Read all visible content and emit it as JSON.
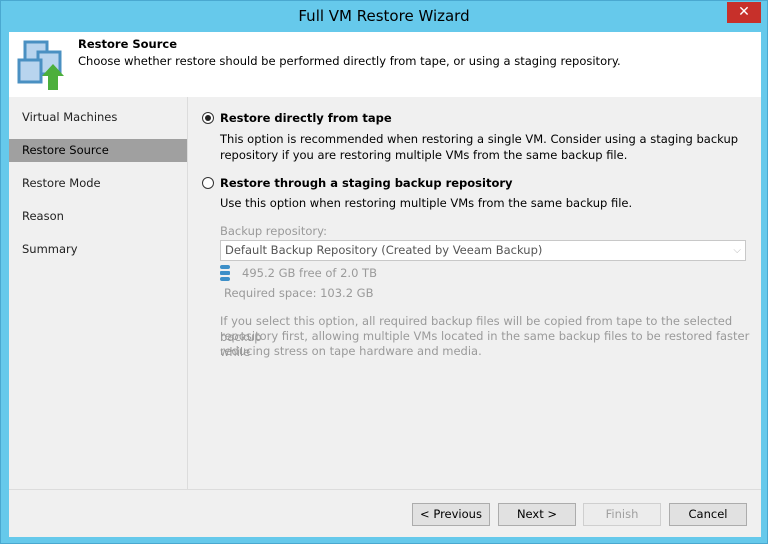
{
  "window": {
    "title": "Full VM Restore Wizard",
    "close": "✕"
  },
  "header": {
    "title": "Restore Source",
    "description": "Choose whether restore should be performed directly from tape, or using a staging repository."
  },
  "nav": [
    "Virtual Machines",
    "Restore Source",
    "Restore Mode",
    "Reason",
    "Summary"
  ],
  "options": {
    "direct": {
      "label": "Restore directly from tape",
      "desc1": "This option is recommended when restoring a single VM. Consider using a staging backup",
      "desc2": "repository if you are restoring multiple VMs from the same backup file."
    },
    "staging": {
      "label": "Restore through a staging backup repository",
      "desc": "Use this option when restoring multiple VMs from the same backup file.",
      "repo_label": "Backup repository:",
      "repo_value": "Default Backup Repository (Created by Veeam Backup)",
      "free": "495.2 GB free of 2.0 TB",
      "required": "Required space:  103.2 GB",
      "note1": "If you select this option, all required backup files will be copied from tape to the selected backup",
      "note2": "repository first, allowing multiple VMs located in the same backup files to be restored faster while",
      "note3": "reducing stress on tape hardware and media."
    }
  },
  "buttons": {
    "previous": "< Previous",
    "next": "Next >",
    "finish": "Finish",
    "cancel": "Cancel"
  }
}
